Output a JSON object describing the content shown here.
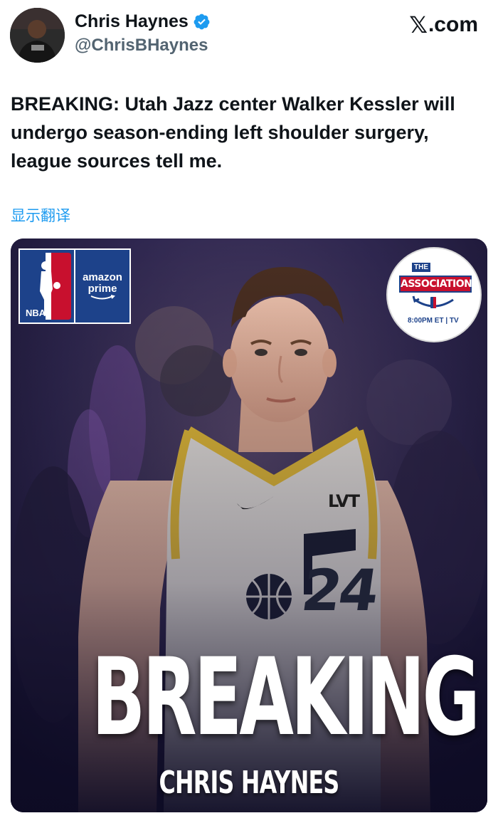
{
  "author": {
    "name": "Chris Haynes",
    "handle": "@ChrisBHaynes",
    "verified_icon": "verified-badge-icon"
  },
  "site": {
    "x_mark": "𝕏",
    "label": ".com"
  },
  "tweet": {
    "text": "BREAKING: Utah Jazz center Walker Kessler will undergo season-ending left shoulder surgery, league sources tell me.",
    "translate_link": "显示翻译"
  },
  "media": {
    "nba_badge": {
      "league": "NBA",
      "partner_line1": "amazon",
      "partner_line2": "prime"
    },
    "association_badge": {
      "top": "THE",
      "title": "ASSOCIATION",
      "time": "8:00PM ET | TV"
    },
    "jersey_brand": "LVT",
    "jersey_number": "24",
    "headline": "BREAKING",
    "byline": "CHRIS HAYNES"
  },
  "colors": {
    "accent": "#1d9bf0",
    "nba_blue": "#1d428a",
    "nba_red": "#c8102e",
    "jazz_yellow": "#e9c03a"
  }
}
